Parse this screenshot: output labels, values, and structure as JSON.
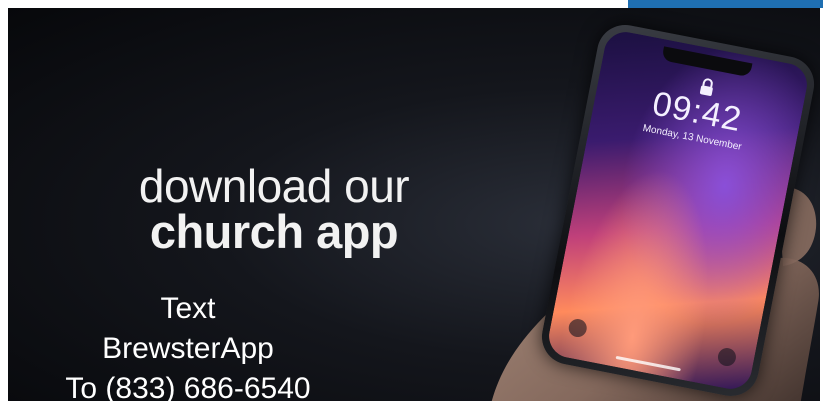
{
  "banner": {
    "headline_line1": "download our",
    "headline_line2": "church app",
    "sms_line1": "Text",
    "sms_line2": "BrewsterApp",
    "sms_line3": "To (833) 686-6540"
  },
  "phone": {
    "time": "09:42",
    "date": "Monday, 13 November"
  },
  "colors": {
    "accent_strip": "#1f6fb2",
    "text": "#ffffff"
  },
  "icons": [
    "lock-icon",
    "flashlight-icon",
    "camera-icon"
  ]
}
